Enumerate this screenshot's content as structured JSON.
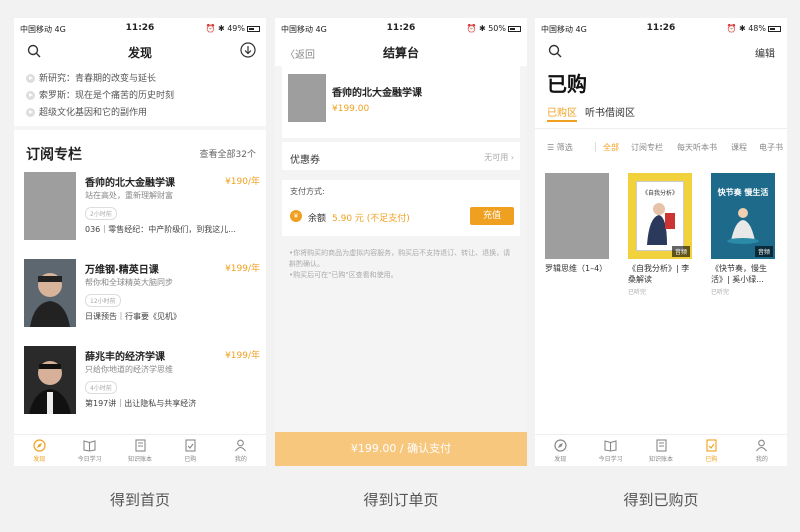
{
  "status": [
    {
      "carrier": "中国移动",
      "net": "4G",
      "time": "11:26",
      "battery": "49%"
    },
    {
      "carrier": "中国移动",
      "net": "4G",
      "time": "11:26",
      "battery": "50%"
    },
    {
      "carrier": "中国移动",
      "net": "4G",
      "time": "11:26",
      "battery": "48%"
    }
  ],
  "home": {
    "title": "发现",
    "news": [
      "新研究：青春期的改变与延长",
      "索罗斯：现在是个痛苦的历史时刻",
      "超级文化基因和它的副作用"
    ],
    "section_title": "订阅专栏",
    "section_more": "查看全部32个",
    "courses": [
      {
        "title": "香帅的北大金融学课",
        "price": "¥190/年",
        "desc": "站在高处，重新理解财富",
        "tag": "2小时前",
        "update": "036｜零售经纪：中产阶级们，到我这儿..."
      },
      {
        "title": "万维钢·精英日课",
        "price": "¥199/年",
        "desc": "帮你和全球精英大脑同步",
        "tag": "12小时前",
        "update": "日课预告｜行事要《见机》"
      },
      {
        "title": "薛兆丰的经济学课",
        "price": "¥199/年",
        "desc": "只给你地道的经济学思维",
        "tag": "4小时前",
        "update": "第197讲｜出让隐私与共享经济"
      }
    ],
    "tabs": [
      "发现",
      "今日学习",
      "知识账本",
      "已购",
      "我的"
    ]
  },
  "checkout": {
    "back": "返回",
    "title": "结算台",
    "product_title": "香帅的北大金融学课",
    "product_price": "¥199.00",
    "coupon_label": "优惠券",
    "coupon_value": "无可用",
    "pay_method_label": "支付方式:",
    "balance_label": "余额",
    "balance_value": "5.90 元 (不足支付)",
    "recharge": "充值",
    "notice_1": "•你将购买的商品为虚拟内容服务，购买后不支持退订、转让、退换，请斟酌确认。",
    "notice_2": "•购买后可在\"已购\"区查看和使用。",
    "pay_button": "¥199.00 / 确认支付"
  },
  "purchased": {
    "edit": "编辑",
    "title": "已购",
    "tab_active": "已购区",
    "tab_other": "听书借阅区",
    "filter_label": "筛选",
    "filters": [
      "全部",
      "订阅专栏",
      "每天听本书",
      "课程",
      "电子书"
    ],
    "books": [
      {
        "title": "罗辑思维（1–4）",
        "sub": "",
        "badge": ""
      },
      {
        "title": "《自我分析》| 李桑解读",
        "sub": "已听完",
        "badge": "音频",
        "cover_text": "《自我分析》"
      },
      {
        "title": "《快节奏，慢生活》| 奚小绿...",
        "sub": "已听完",
        "badge": "音频",
        "cover_text": "快节奏 慢生活"
      }
    ],
    "tabs": [
      "发现",
      "今日学习",
      "知识账本",
      "已购",
      "我的"
    ]
  },
  "captions": [
    "得到首页",
    "得到订单页",
    "得到已购页"
  ],
  "colors": {
    "accent": "#f0a020",
    "pay_button": "#f8c77e"
  }
}
